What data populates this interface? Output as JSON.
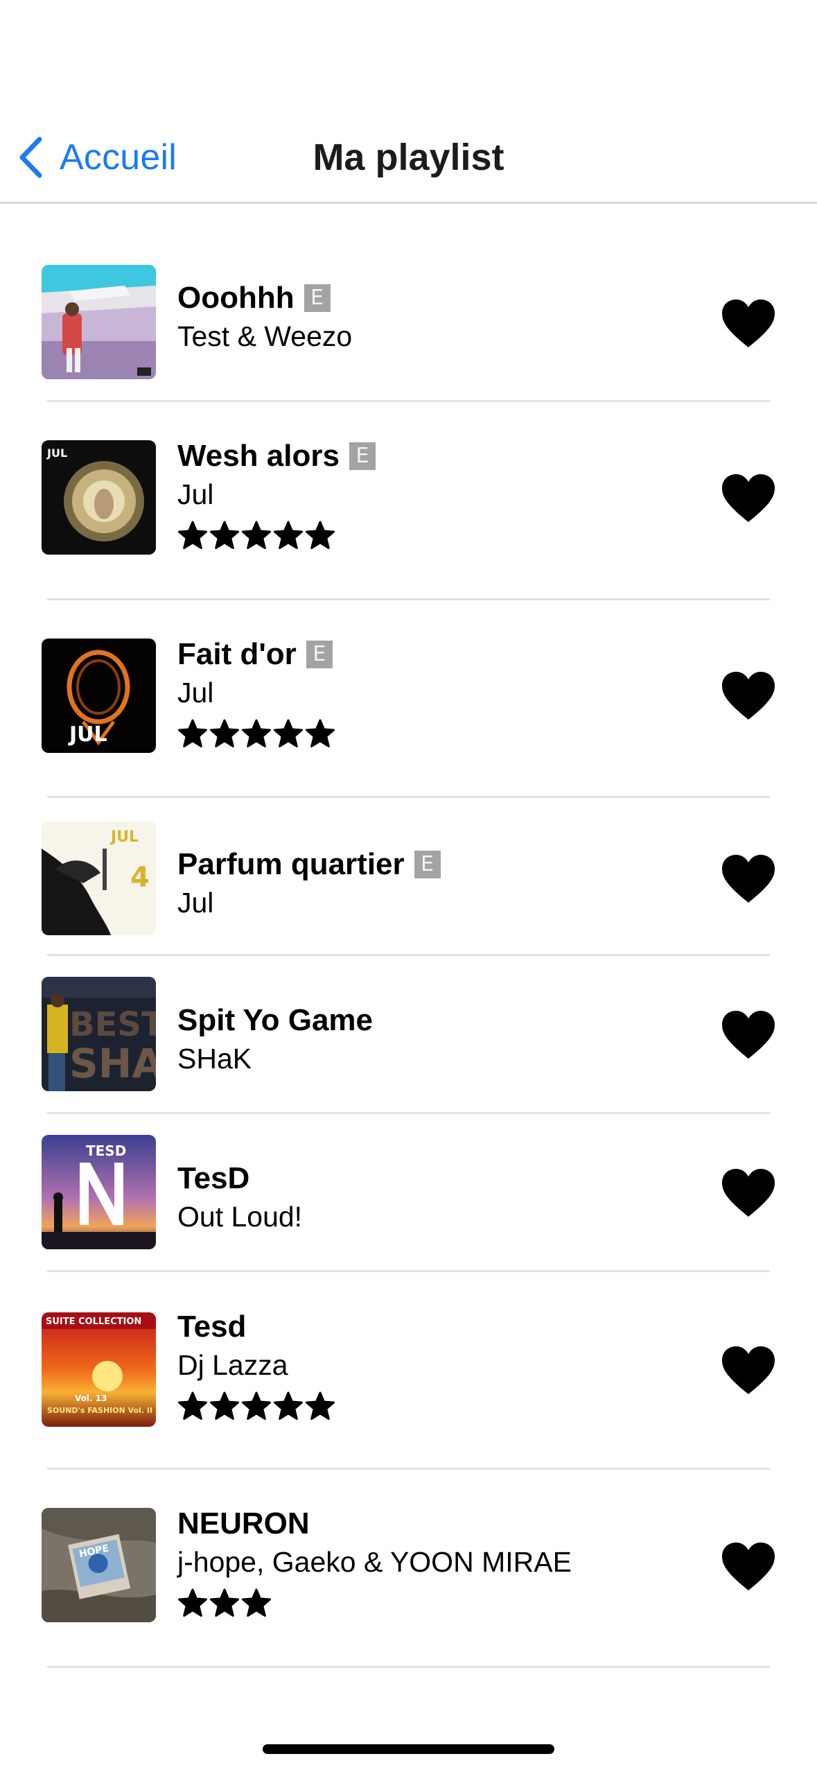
{
  "nav": {
    "back_label": "Accueil",
    "title": "Ma playlist"
  },
  "explicit_label": "E",
  "colors": {
    "accent": "#1a7bf2",
    "explicit_badge": "#a3a3a3",
    "divider": "#e2e2e5"
  },
  "tracks": [
    {
      "title": "Ooohhh",
      "artist": "Test & Weezo",
      "explicit": true,
      "rating": 0,
      "liked": true
    },
    {
      "title": "Wesh alors",
      "artist": "Jul",
      "explicit": true,
      "rating": 5,
      "liked": true
    },
    {
      "title": "Fait d'or",
      "artist": "Jul",
      "explicit": true,
      "rating": 5,
      "liked": true
    },
    {
      "title": "Parfum quartier",
      "artist": "Jul",
      "explicit": true,
      "rating": 0,
      "liked": true
    },
    {
      "title": "Spit Yo Game",
      "artist": "SHaK",
      "explicit": false,
      "rating": 0,
      "liked": true
    },
    {
      "title": "TesD",
      "artist": "Out Loud!",
      "explicit": false,
      "rating": 0,
      "liked": true
    },
    {
      "title": "Tesd",
      "artist": "Dj Lazza",
      "explicit": false,
      "rating": 5,
      "liked": true
    },
    {
      "title": "NEURON",
      "artist": "j-hope, Gaeko & YOON MIRAE",
      "explicit": false,
      "rating": 3,
      "liked": true
    }
  ]
}
